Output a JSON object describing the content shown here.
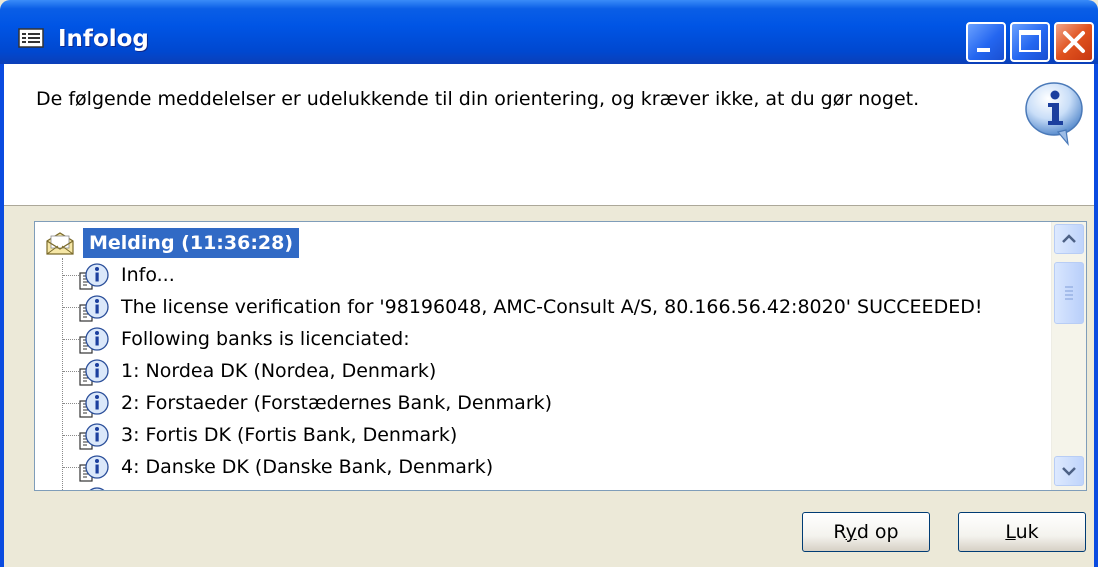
{
  "window": {
    "title": "Infolog"
  },
  "message": {
    "text": "De følgende meddelelser er udelukkende til din orientering, og kræver ikke, at du gør noget."
  },
  "tree": {
    "root_label": "Melding (11:36:28)",
    "items": [
      {
        "text": "Info..."
      },
      {
        "text": "The license verification for '98196048, AMC-Consult A/S, 80.166.56.42:8020' SUCCEEDED!"
      },
      {
        "text": "Following banks is licenciated:"
      },
      {
        "text": "1: Nordea DK (Nordea, Denmark)"
      },
      {
        "text": "2: Forstaeder (Forstædernes Bank, Denmark)"
      },
      {
        "text": "3: Fortis DK (Fortis Bank, Denmark)"
      },
      {
        "text": "4: Danske DK (Danske Bank, Denmark)"
      }
    ]
  },
  "buttons": {
    "cleanup_pre": "R",
    "cleanup_acc": "y",
    "cleanup_post": "d op",
    "close_pre": "",
    "close_acc": "L",
    "close_post": "uk"
  },
  "colors": {
    "selection": "#316ac5",
    "titlebar": "#0055e5",
    "face": "#ece9d8",
    "close": "#e0521e"
  },
  "icons": {
    "window": "form-icon",
    "info": "info-bubble-icon",
    "root": "envelope-icon",
    "item": "info-doc-icon"
  }
}
